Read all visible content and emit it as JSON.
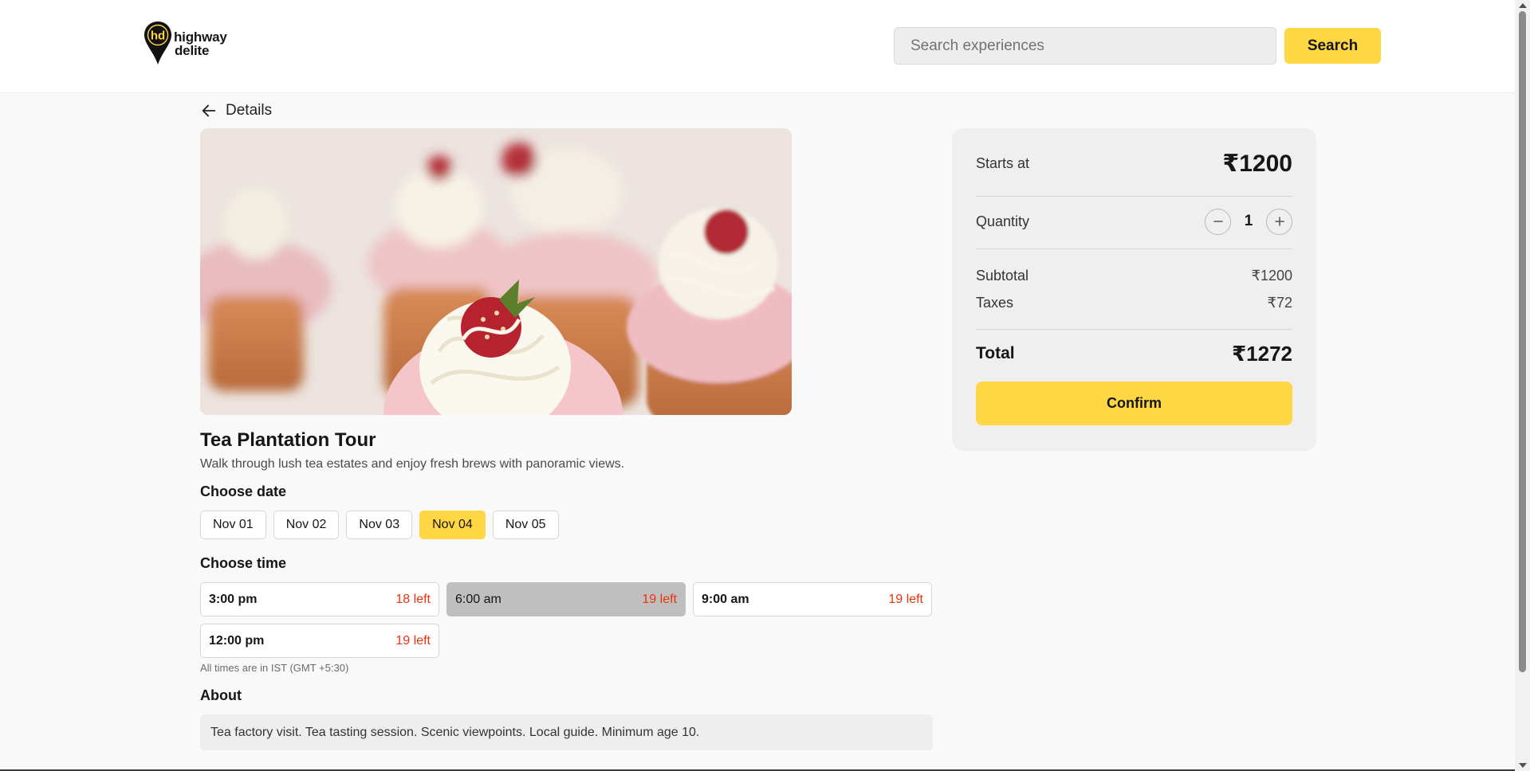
{
  "header": {
    "logo": {
      "mark": "hd",
      "line1": "highway",
      "line2": "delite"
    },
    "search": {
      "placeholder": "Search experiences",
      "value": "",
      "button_label": "Search"
    }
  },
  "nav": {
    "back_icon": "arrow-left-icon",
    "back_label": "Details"
  },
  "experience": {
    "title": "Tea Plantation Tour",
    "description": "Walk through lush tea estates and enjoy fresh brews with panoramic views."
  },
  "date_section": {
    "heading": "Choose date",
    "dates": [
      "Nov 01",
      "Nov 02",
      "Nov 03",
      "Nov 04",
      "Nov 05"
    ],
    "selected": "Nov 04"
  },
  "time_section": {
    "heading": "Choose time",
    "slots": [
      {
        "time": "3:00 pm",
        "left": "18 left"
      },
      {
        "time": "6:00 am",
        "left": "19 left"
      },
      {
        "time": "9:00 am",
        "left": "19 left"
      },
      {
        "time": "12:00 pm",
        "left": "19 left"
      }
    ],
    "selected": "6:00 am",
    "note": "All times are in IST (GMT +5:30)"
  },
  "about": {
    "heading": "About",
    "text": "Tea factory visit. Tea tasting session. Scenic viewpoints. Local guide. Minimum age 10."
  },
  "summary": {
    "starts_at_label": "Starts at",
    "starts_at_value": "₹1200",
    "quantity_label": "Quantity",
    "quantity_value": "1",
    "subtotal_label": "Subtotal",
    "subtotal_value": "₹1200",
    "taxes_label": "Taxes",
    "taxes_value": "₹72",
    "total_label": "Total",
    "total_value": "₹1272",
    "confirm_label": "Confirm",
    "minus_icon": "minus-icon",
    "plus_icon": "plus-icon"
  },
  "colors": {
    "accent": "#ffd643",
    "slots_left": "#e9330e",
    "selected_slot": "#bfbfbf",
    "page_bg": "#f9f9f9",
    "card_bg": "#efefef"
  }
}
